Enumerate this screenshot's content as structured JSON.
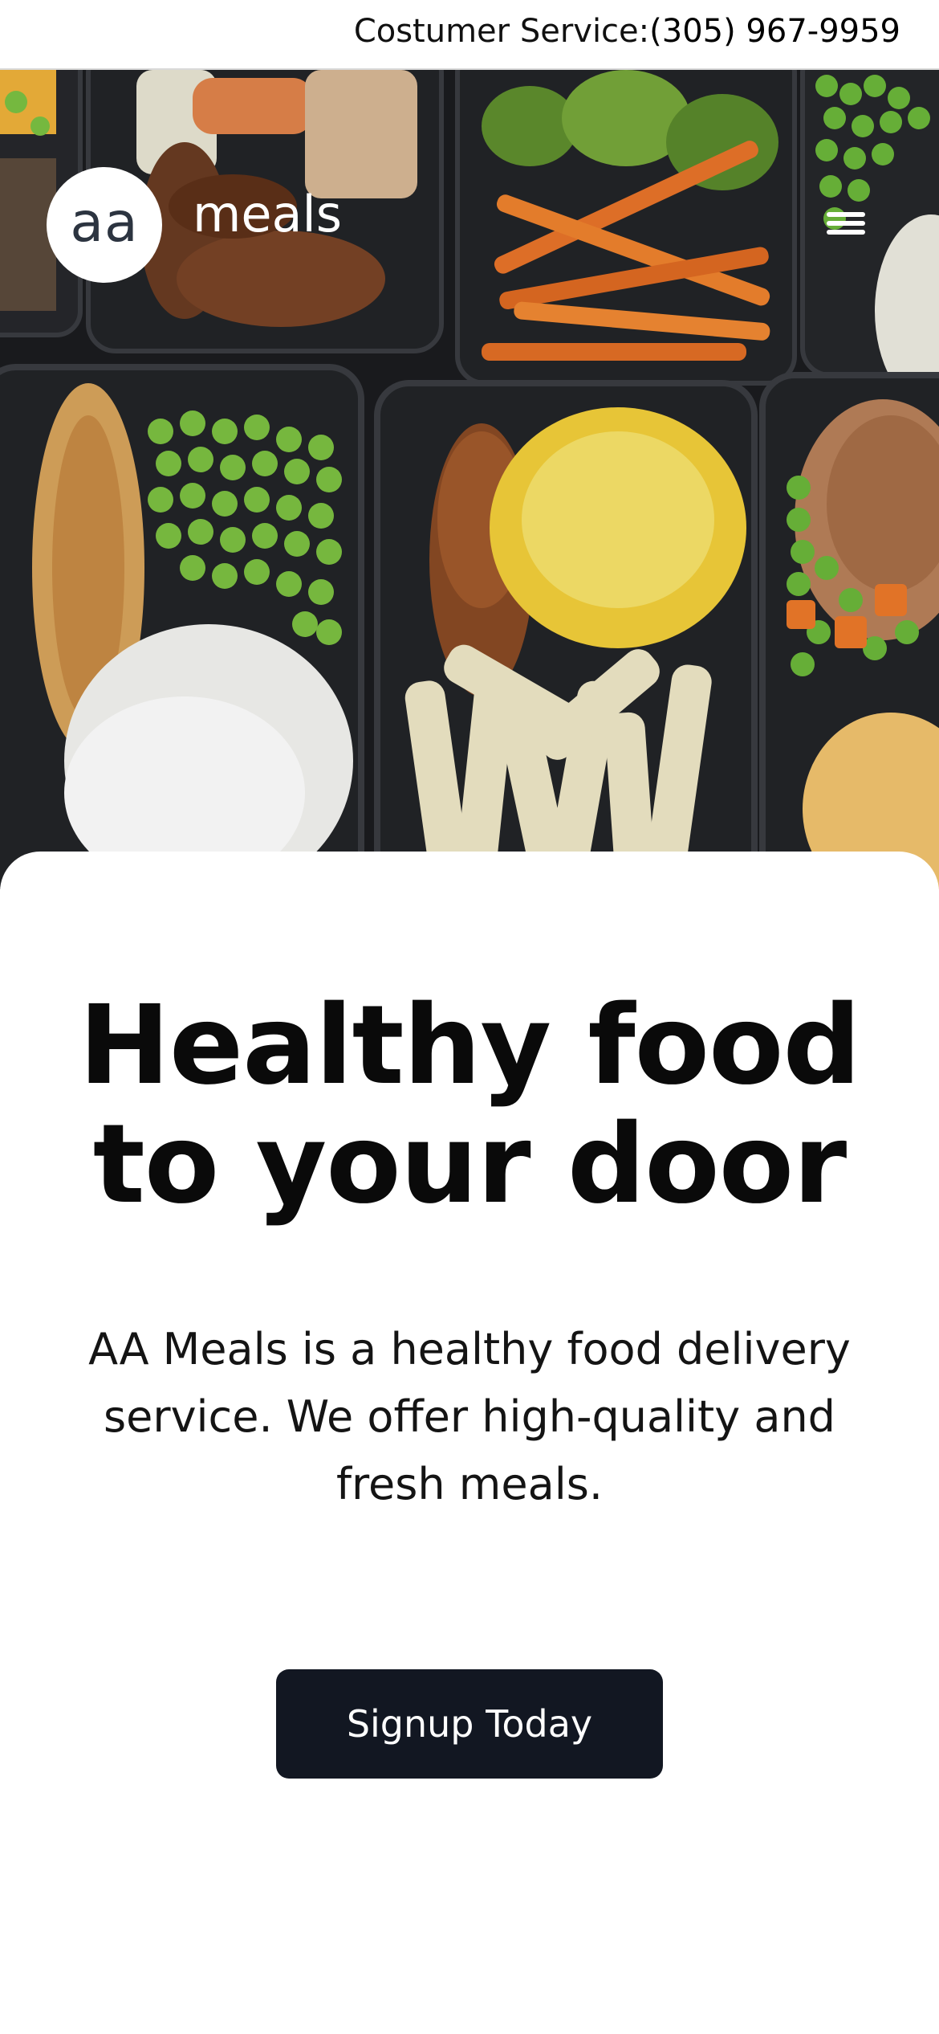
{
  "topbar": {
    "customer_service_label": "Costumer Service:",
    "phone": "(305) 967-9959"
  },
  "brand": {
    "logo_initials": "aa",
    "wordmark": "meals"
  },
  "hero": {
    "image_alt": "meal prep containers"
  },
  "main": {
    "headline": "Healthy food to your door",
    "description": "AA Meals is a healthy food delivery service. We offer high-quality and fresh meals.",
    "cta_label": "Signup Today"
  },
  "colors": {
    "cta_bg": "#121722",
    "text_dark": "#0a0a0a",
    "background": "#ffffff"
  }
}
